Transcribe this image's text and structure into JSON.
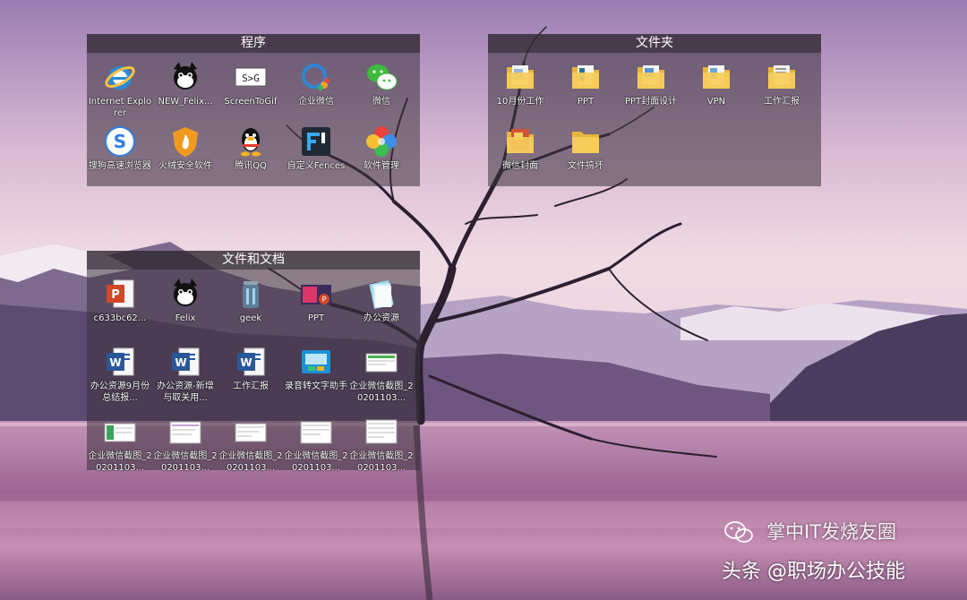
{
  "fences": {
    "programs": {
      "title": "程序",
      "items": [
        {
          "label": "Internet Explorer",
          "icon": "internet-explorer-icon"
        },
        {
          "label": "NEW_Felix...",
          "icon": "felix-cat-icon"
        },
        {
          "label": "ScreenToGif",
          "icon": "screentogif-icon"
        },
        {
          "label": "企业微信",
          "icon": "wecom-icon"
        },
        {
          "label": "微信",
          "icon": "wechat-icon"
        },
        {
          "label": "搜狗高速浏览器",
          "icon": "sogou-browser-icon"
        },
        {
          "label": "火绒安全软件",
          "icon": "huorong-security-icon"
        },
        {
          "label": "腾讯QQ",
          "icon": "qq-penguin-icon"
        },
        {
          "label": "自定义Fences",
          "icon": "fences-icon"
        },
        {
          "label": "软件管理",
          "icon": "software-manager-icon"
        }
      ]
    },
    "folders": {
      "title": "文件夹",
      "items": [
        {
          "label": "10月份工作",
          "icon": "folder-icon"
        },
        {
          "label": "PPT",
          "icon": "folder-icon"
        },
        {
          "label": "PPT封面设计",
          "icon": "folder-icon"
        },
        {
          "label": "VPN",
          "icon": "folder-icon"
        },
        {
          "label": "工作汇报",
          "icon": "folder-icon"
        },
        {
          "label": "微信封面",
          "icon": "folder-icon"
        },
        {
          "label": "文件搞坏",
          "icon": "folder-icon"
        }
      ]
    },
    "documents": {
      "title": "文件和文档",
      "items": [
        {
          "label": "c633bc62...",
          "icon": "powerpoint-file-icon"
        },
        {
          "label": "Felix",
          "icon": "felix-cat-icon"
        },
        {
          "label": "geek",
          "icon": "geek-uninstaller-icon"
        },
        {
          "label": "PPT",
          "icon": "ppt-image-icon"
        },
        {
          "label": "办公资源",
          "icon": "office-resource-icon"
        },
        {
          "label": "办公资源9月份总结报...",
          "icon": "word-file-icon"
        },
        {
          "label": "办公资源-新增与取关用...",
          "icon": "word-file-icon"
        },
        {
          "label": "工作汇报",
          "icon": "word-file-icon"
        },
        {
          "label": "录音转文字助手",
          "icon": "recorder-app-icon"
        },
        {
          "label": "企业微信截图_20201103...",
          "icon": "screenshot-file-icon"
        },
        {
          "label": "企业微信截图_20201103...",
          "icon": "screenshot-file-icon"
        },
        {
          "label": "企业微信截图_20201103...",
          "icon": "screenshot-file-icon"
        },
        {
          "label": "企业微信截图_20201103...",
          "icon": "screenshot-file-icon"
        },
        {
          "label": "企业微信截图_20201103...",
          "icon": "screenshot-file-icon"
        },
        {
          "label": "企业微信截图_20201103...",
          "icon": "screenshot-file-icon"
        }
      ]
    }
  },
  "watermark": {
    "top": "掌中IT发烧友圈",
    "bottom": "头条 @职场办公技能"
  },
  "colors": {
    "fence_bg": "#3a323c",
    "folder_yellow": "#f3c94b",
    "word_blue": "#2b579a",
    "ppt_orange": "#d24726"
  }
}
